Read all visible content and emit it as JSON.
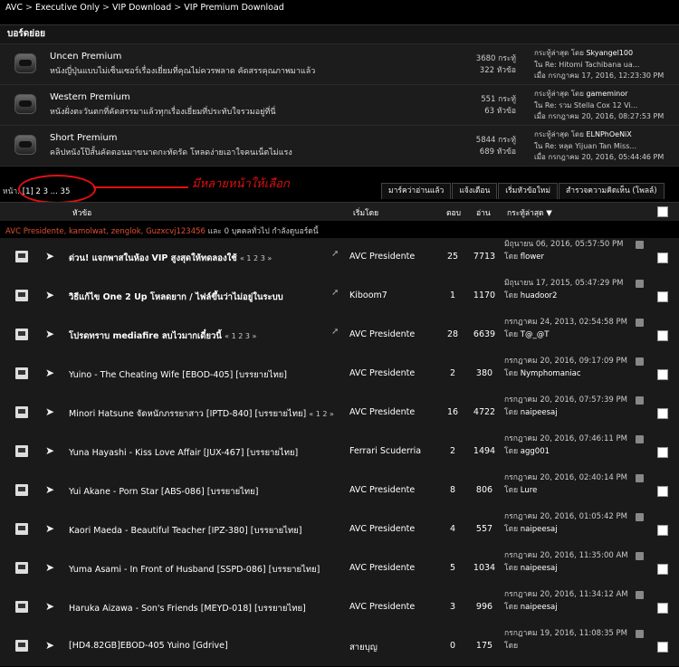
{
  "breadcrumb": [
    "AVC",
    "Executive Only",
    "VIP Download",
    "VIP Premium Download"
  ],
  "subforums": {
    "heading": "บอร์ดย่อย",
    "items": [
      {
        "name": "Uncen Premium",
        "desc": "หนังญี่ปุ่นแบบไม่เซ็นเซอร์เรื่องเยี่ยมที่คุณไม่ควรพลาด คัดสรรคุณภาพมาแล้ว",
        "posts": "3680 กระทู้",
        "topics": "322 หัวข้อ",
        "last_label": "กระทู้ล่าสุด โดย",
        "last_user": "Skyangel100",
        "last_in": "ใน Re: Hitomi Tachibana ua...",
        "last_date": "เมื่อ กรกฎาคม 17, 2016, 12:23:30 PM"
      },
      {
        "name": "Western Premium",
        "desc": "หนังฝั่งตะวันตกที่คัดสรรมาแล้วทุกเรื่องเยี่ยมที่ประทับใจรวมอยู่ที่นี่",
        "posts": "551 กระทู้",
        "topics": "63 หัวข้อ",
        "last_label": "กระทู้ล่าสุด โดย",
        "last_user": "gameminor",
        "last_in": "ใน Re: รวม Stella Cox 12 Vi...",
        "last_date": "เมื่อ กรกฎาคม 20, 2016, 08:27:53 PM"
      },
      {
        "name": "Short Premium",
        "desc": "คลิปหนังโป๊สั้นคัดตอนมาขนาดกะทัดรัด โหลดง่ายเอาใจคนเน็ตไม่แรง",
        "posts": "5844 กระทู้",
        "topics": "689 หัวข้อ",
        "last_label": "กระทู้ล่าสุด โดย",
        "last_user": "ELNPhOeNiX",
        "last_in": "ใน Re: หลุด Yijuan Tan Miss...",
        "last_date": "เมื่อ กรกฎาคม 20, 2016, 05:44:46 PM"
      }
    ]
  },
  "pagination": {
    "label": "หน้า:",
    "pages": "[1] 2 3 ... 35"
  },
  "annotation": "มีหลายหน้าให้เลือก",
  "action_tabs": [
    "มาร์คว่าอ่านแล้ว",
    "แจ้งเตือน",
    "เริ่มหัวข้อใหม่",
    "สำรวจความคิดเห็น (โพลล์)"
  ],
  "columns": {
    "subject": "หัวข้อ",
    "starter": "เริ่มโดย",
    "replies": "ตอบ",
    "views": "อ่าน",
    "last_post": "กระทู้ล่าสุด ▼"
  },
  "viewing": {
    "users_red": "AVC Presidente, kamolwat, zenglok, Guzxcvj123456",
    "rest": " และ 0 บุคคลทั่วไป กำลังดูบอร์ดนี้"
  },
  "topics": [
    {
      "title": "ด่วน! แจกพาสในห้อง VIP สูงสุดให้ทดลองใช้",
      "pages": "« 1 2 3 »",
      "bold": true,
      "pinned": true,
      "starter": "AVC Presidente",
      "replies": "25",
      "views": "7713",
      "date": "มิถุนายน 06, 2016, 05:57:50 PM",
      "by": "โดย",
      "user": "flower"
    },
    {
      "title": "วิธีแก้ไข One 2 Up โหลดยาก / ไฟล์ขึ้นว่าไม่อยู่ในระบบ",
      "pages": "",
      "bold": true,
      "pinned": true,
      "starter": "Kiboom7",
      "replies": "1",
      "views": "1170",
      "date": "มิถุนายน 17, 2015, 05:47:29 PM",
      "by": "โดย",
      "user": "huadoor2"
    },
    {
      "title": "โปรดทราบ mediafire ลบไวมากเดี๋ยวนี้",
      "pages": "« 1 2 3 »",
      "bold": true,
      "pinned": true,
      "starter": "AVC Presidente",
      "replies": "28",
      "views": "6639",
      "date": "กรกฎาคม 24, 2013, 02:54:58 PM",
      "by": "โดย",
      "user": "T@_@T"
    },
    {
      "title": "Yuino - The Cheating Wife [EBOD-405] [บรรยายไทย]",
      "pages": "",
      "bold": false,
      "pinned": false,
      "starter": "AVC Presidente",
      "replies": "2",
      "views": "380",
      "date": "กรกฎาคม 20, 2016, 09:17:09 PM",
      "by": "โดย",
      "user": "Nymphomaniac"
    },
    {
      "title": "Minori Hatsune จัดหนักภรรยาสาว [IPTD-840] [บรรยายไทย]",
      "pages": "« 1 2 »",
      "bold": false,
      "pinned": false,
      "starter": "AVC Presidente",
      "replies": "16",
      "views": "4722",
      "date": "กรกฎาคม 20, 2016, 07:57:39 PM",
      "by": "โดย",
      "user": "naipeesaj"
    },
    {
      "title": "Yuna Hayashi - Kiss Love Affair [JUX-467] [บรรยายไทย]",
      "pages": "",
      "bold": false,
      "pinned": false,
      "starter": "Ferrari Scuderria",
      "replies": "2",
      "views": "1494",
      "date": "กรกฎาคม 20, 2016, 07:46:11 PM",
      "by": "โดย",
      "user": "agg001"
    },
    {
      "title": "Yui Akane - Porn Star [ABS-086] [บรรยายไทย]",
      "pages": "",
      "bold": false,
      "pinned": false,
      "starter": "AVC Presidente",
      "replies": "8",
      "views": "806",
      "date": "กรกฎาคม 20, 2016, 02:40:14 PM",
      "by": "โดย",
      "user": "Lure"
    },
    {
      "title": "Kaori Maeda - Beautiful Teacher [IPZ-380] [บรรยายไทย]",
      "pages": "",
      "bold": false,
      "pinned": false,
      "starter": "AVC Presidente",
      "replies": "4",
      "views": "557",
      "date": "กรกฎาคม 20, 2016, 01:05:42 PM",
      "by": "โดย",
      "user": "naipeesaj"
    },
    {
      "title": "Yuma Asami - In Front of Husband [SSPD-086] [บรรยายไทย]",
      "pages": "",
      "bold": false,
      "pinned": false,
      "starter": "AVC Presidente",
      "replies": "5",
      "views": "1034",
      "date": "กรกฎาคม 20, 2016, 11:35:00 AM",
      "by": "โดย",
      "user": "naipeesaj"
    },
    {
      "title": "Haruka Aizawa - Son's Friends [MEYD-018] [บรรยายไทย]",
      "pages": "",
      "bold": false,
      "pinned": false,
      "starter": "AVC Presidente",
      "replies": "3",
      "views": "996",
      "date": "กรกฎาคม 20, 2016, 11:34:12 AM",
      "by": "โดย",
      "user": "naipeesaj"
    },
    {
      "title": "[HD4.82GB]EBOD-405 Yuino [Gdrive]",
      "pages": "",
      "bold": false,
      "pinned": false,
      "starter": "สายบุญ",
      "replies": "0",
      "views": "175",
      "date": "กรกฎาคม 19, 2016, 11:08:35 PM",
      "by": "โดย",
      "user": ""
    }
  ]
}
